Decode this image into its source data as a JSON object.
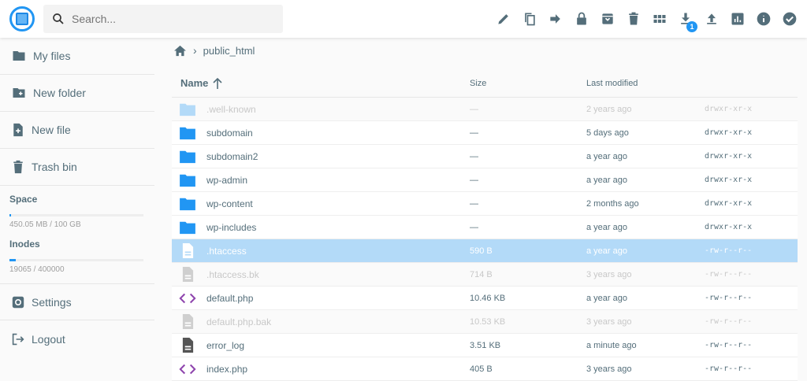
{
  "header": {
    "search_placeholder": "Search...",
    "download_badge": "1"
  },
  "toolbar": [
    "pencil-icon",
    "copy-icon",
    "move-icon",
    "lock-icon",
    "archive-icon",
    "trash-icon",
    "grid-icon",
    "download-icon",
    "upload-icon",
    "chart-icon",
    "info-icon",
    "check-circle-icon"
  ],
  "sidebar": {
    "items": [
      {
        "label": "My files"
      },
      {
        "label": "New folder"
      },
      {
        "label": "New file"
      },
      {
        "label": "Trash bin"
      }
    ],
    "space": {
      "title": "Space",
      "text": "450.05 MB / 100 GB",
      "fraction": 0.0045
    },
    "inodes": {
      "title": "Inodes",
      "text": "19065 / 400000",
      "fraction": 0.0477
    },
    "settings": "Settings",
    "logout": "Logout"
  },
  "breadcrumb": {
    "path": "public_html"
  },
  "table": {
    "headers": {
      "name": "Name",
      "size": "Size",
      "modified": "Last modified"
    },
    "rows": [
      {
        "type": "folder",
        "name": ".well-known",
        "size": "—",
        "modified": "2 years ago",
        "perm": "drwxr-xr-x",
        "state": "dim"
      },
      {
        "type": "folder",
        "name": "subdomain",
        "size": "—",
        "modified": "5 days ago",
        "perm": "drwxr-xr-x",
        "state": ""
      },
      {
        "type": "folder",
        "name": "subdomain2",
        "size": "—",
        "modified": "a year ago",
        "perm": "drwxr-xr-x",
        "state": ""
      },
      {
        "type": "folder",
        "name": "wp-admin",
        "size": "—",
        "modified": "a year ago",
        "perm": "drwxr-xr-x",
        "state": ""
      },
      {
        "type": "folder",
        "name": "wp-content",
        "size": "—",
        "modified": "2 months ago",
        "perm": "drwxr-xr-x",
        "state": ""
      },
      {
        "type": "folder",
        "name": "wp-includes",
        "size": "—",
        "modified": "a year ago",
        "perm": "drwxr-xr-x",
        "state": ""
      },
      {
        "type": "file",
        "name": ".htaccess",
        "size": "590 B",
        "modified": "a year ago",
        "perm": "-rw-r--r--",
        "state": "sel"
      },
      {
        "type": "file",
        "name": ".htaccess.bk",
        "size": "714 B",
        "modified": "3 years ago",
        "perm": "-rw-r--r--",
        "state": "dim"
      },
      {
        "type": "code",
        "name": "default.php",
        "size": "10.46 KB",
        "modified": "a year ago",
        "perm": "-rw-r--r--",
        "state": ""
      },
      {
        "type": "file",
        "name": "default.php.bak",
        "size": "10.53 KB",
        "modified": "3 years ago",
        "perm": "-rw-r--r--",
        "state": "dim"
      },
      {
        "type": "file",
        "name": "error_log",
        "size": "3.51 KB",
        "modified": "a minute ago",
        "perm": "-rw-r--r--",
        "state": ""
      },
      {
        "type": "code",
        "name": "index.php",
        "size": "405 B",
        "modified": "3 years ago",
        "perm": "-rw-r--r--",
        "state": ""
      }
    ]
  },
  "colors": {
    "accent": "#2196f3",
    "folder": "#2196f3",
    "code": "#8e44ad",
    "selected": "#b3daf8"
  }
}
